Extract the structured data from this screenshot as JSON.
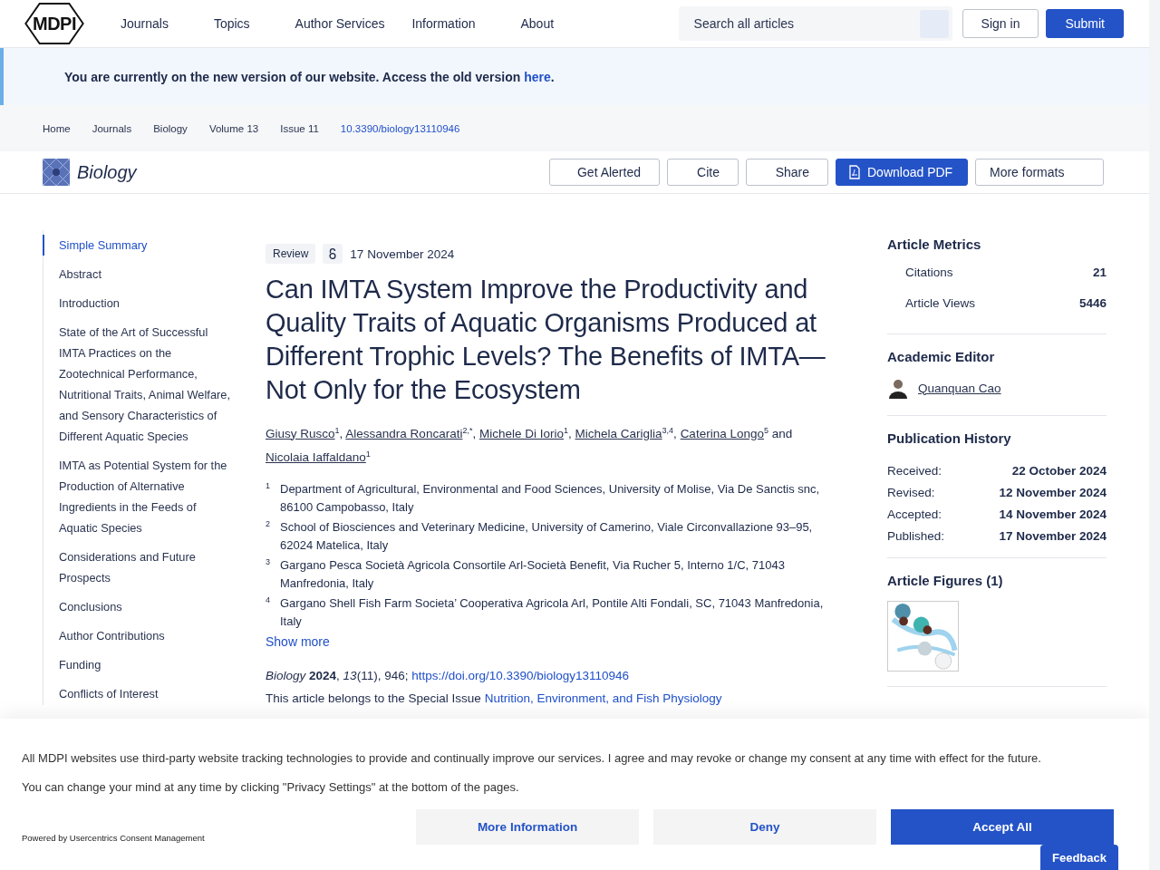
{
  "header": {
    "logo": "MDPI",
    "menu": [
      "Journals",
      "Topics",
      "Author Services",
      "Information",
      "About"
    ],
    "search": {
      "placeholder": "Search all articles"
    },
    "buttons": [
      {
        "label": "Sign in",
        "kind": "outline"
      },
      {
        "label": "Submit",
        "kind": "primary"
      }
    ]
  },
  "notice": {
    "text": "You are currently on the new version of our website. Access the old version ",
    "link": "here",
    "end": "."
  },
  "breadcrumb": [
    {
      "label": "Home",
      "kind": "crumb"
    },
    {
      "label": "Journals",
      "kind": "crumb"
    },
    {
      "label": "Biology",
      "kind": "crumb"
    },
    {
      "label": "Volume 13",
      "kind": "crumb"
    },
    {
      "label": "Issue 11",
      "kind": "crumb"
    },
    {
      "label": "10.3390/biology13110946",
      "kind": "link"
    }
  ],
  "journal": {
    "name": "Biology",
    "actions": [
      {
        "label": "Get Alerted",
        "kind": "outline"
      },
      {
        "label": "Cite",
        "kind": "outline"
      },
      {
        "label": "Share",
        "kind": "outline"
      },
      {
        "label": "Download PDF",
        "kind": "primary"
      },
      {
        "label": "More formats",
        "kind": "outline"
      }
    ]
  },
  "toc": [
    {
      "label": "Simple Summary",
      "selected": true
    },
    {
      "label": "Abstract",
      "selected": false
    },
    {
      "label": "Introduction",
      "selected": false
    },
    {
      "label": "State of the Art of Successful IMTA Practices on the Zootechnical Performance, Nutritional Traits, Animal Welfare, and Sensory Characteristics of Different Aquatic Species",
      "selected": false
    },
    {
      "label": "IMTA as Potential System for the Production of Alternative Ingredients in the Feeds of Aquatic Species",
      "selected": false
    },
    {
      "label": "Considerations and Future Prospects",
      "selected": false
    },
    {
      "label": "Conclusions",
      "selected": false
    },
    {
      "label": "Author Contributions",
      "selected": false
    },
    {
      "label": "Funding",
      "selected": false
    },
    {
      "label": "Conflicts of Interest",
      "selected": false
    }
  ],
  "article": {
    "type": "Review",
    "date": "17 November 2024",
    "title": "Can IMTA System Improve the Productivity and Quality Traits of Aquatic Organisms Produced at Different Trophic Levels? The Benefits of IMTA—Not Only for the Ecosystem",
    "authors": [
      {
        "name": "Giusy Rusco",
        "mark": "1",
        "sep": ","
      },
      {
        "name": "Alessandra Roncarati",
        "mark": "2,*",
        "sep": ","
      },
      {
        "name": "Michele Di Iorio",
        "mark": "1",
        "sep": ","
      },
      {
        "name": "Michela Cariglia",
        "mark": "3,4",
        "sep": ","
      },
      {
        "name": "Caterina Longo",
        "mark": "5"
      },
      {
        "name": "Nicolaia Iaffaldano",
        "mark": "1"
      }
    ],
    "and": "and",
    "affiliations": [
      {
        "num": "1",
        "text": "Department of Agricultural, Environmental and Food Sciences, University of Molise, Via De Sanctis snc, 86100 Campobasso, Italy"
      },
      {
        "num": "2",
        "text": "School of Biosciences and Veterinary Medicine, University of Camerino, Viale Circonvallazione 93–95, 62024 Matelica, Italy"
      },
      {
        "num": "3",
        "text": "Gargano Pesca Società Agricola Consortile Arl-Società Benefit, Via Rucher 5, Interno 1/C, 71043 Manfredonia, Italy"
      },
      {
        "num": "4",
        "text": "Gargano Shell Fish Farm Societa’ Cooperativa Agricola Arl, Pontile Alti Fondali, SC, 71043 Manfredonia, Italy"
      }
    ],
    "show_more": "Show more",
    "citation": "*Biology* **2024**, *13*(11), 946; ",
    "doi": "https://doi.org/10.3390/biology13110946",
    "special_issue_prefix": "This article belongs to the Special Issue ",
    "special_issue": "Nutrition, Environment, and Fish Physiology"
  },
  "sidebar": {
    "metrics_title": "Article Metrics",
    "metrics": [
      {
        "label": "Citations",
        "value": "21"
      },
      {
        "label": "Article Views",
        "value": "5446"
      }
    ],
    "editor_title": "Academic Editor",
    "editor": "Quanquan Cao",
    "history_title": "Publication History",
    "history": [
      {
        "label": "Received:",
        "value": "22 October 2024"
      },
      {
        "label": "Revised:",
        "value": "12 November 2024"
      },
      {
        "label": "Accepted:",
        "value": "14 November 2024"
      },
      {
        "label": "Published:",
        "value": "17 November 2024"
      }
    ],
    "figures_title": "Article Figures (1)"
  },
  "cookie": {
    "text": "All MDPI websites use third-party website tracking technologies to provide and continually improve our services. I agree and may revoke or change my consent at any time with effect for the future.",
    "text2": "You can change your mind at any time by clicking \"Privacy Settings\" at the bottom of the pages.",
    "powered": "Powered by Usercentrics Consent Management",
    "buttons": [
      {
        "label": "More Information",
        "kind": "secondary"
      },
      {
        "label": "Deny",
        "kind": "secondary"
      },
      {
        "label": "Accept All",
        "kind": "primary"
      }
    ]
  },
  "feedback": "Feedback"
}
